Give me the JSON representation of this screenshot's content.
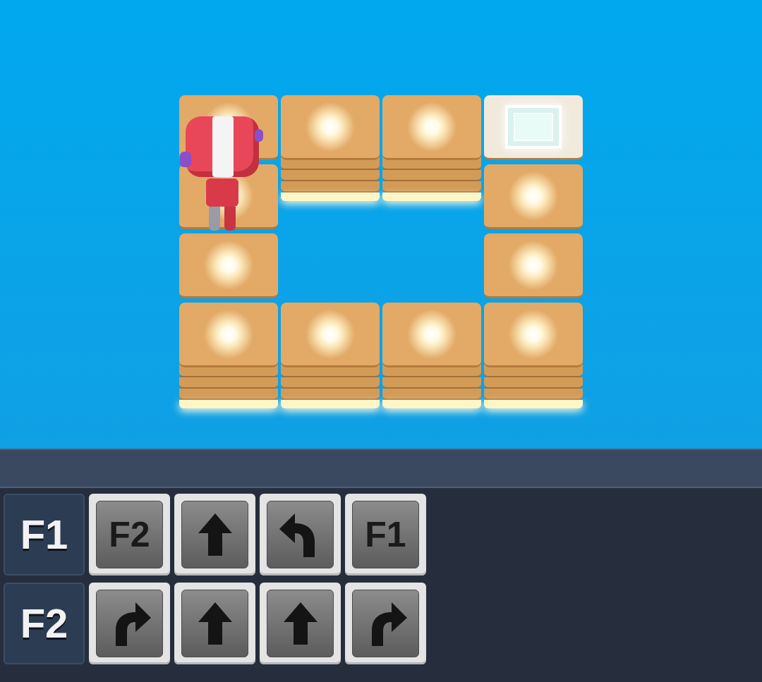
{
  "board": {
    "rows": [
      [
        {
          "kind": "spark",
          "robot": false
        },
        {
          "kind": "spark",
          "robot": false
        },
        {
          "kind": "spark",
          "robot": false
        },
        {
          "kind": "goal",
          "robot": false
        }
      ],
      [
        {
          "kind": "spark",
          "robot": true
        },
        {
          "kind": "empty",
          "robot": false
        },
        {
          "kind": "empty",
          "robot": false
        },
        {
          "kind": "spark",
          "robot": false
        }
      ],
      [
        {
          "kind": "spark",
          "robot": false
        },
        {
          "kind": "empty",
          "robot": false
        },
        {
          "kind": "empty",
          "robot": false
        },
        {
          "kind": "spark",
          "robot": false
        }
      ],
      [
        {
          "kind": "spark",
          "robot": false
        },
        {
          "kind": "spark",
          "robot": false
        },
        {
          "kind": "spark",
          "robot": false
        },
        {
          "kind": "spark",
          "robot": false
        }
      ]
    ]
  },
  "functions": [
    {
      "label": "F1",
      "commands": [
        {
          "kind": "call",
          "label": "F2"
        },
        {
          "kind": "forward"
        },
        {
          "kind": "turn-left"
        },
        {
          "kind": "call",
          "label": "F1"
        }
      ]
    },
    {
      "label": "F2",
      "commands": [
        {
          "kind": "turn-right"
        },
        {
          "kind": "forward"
        },
        {
          "kind": "forward"
        },
        {
          "kind": "turn-right"
        }
      ]
    }
  ]
}
